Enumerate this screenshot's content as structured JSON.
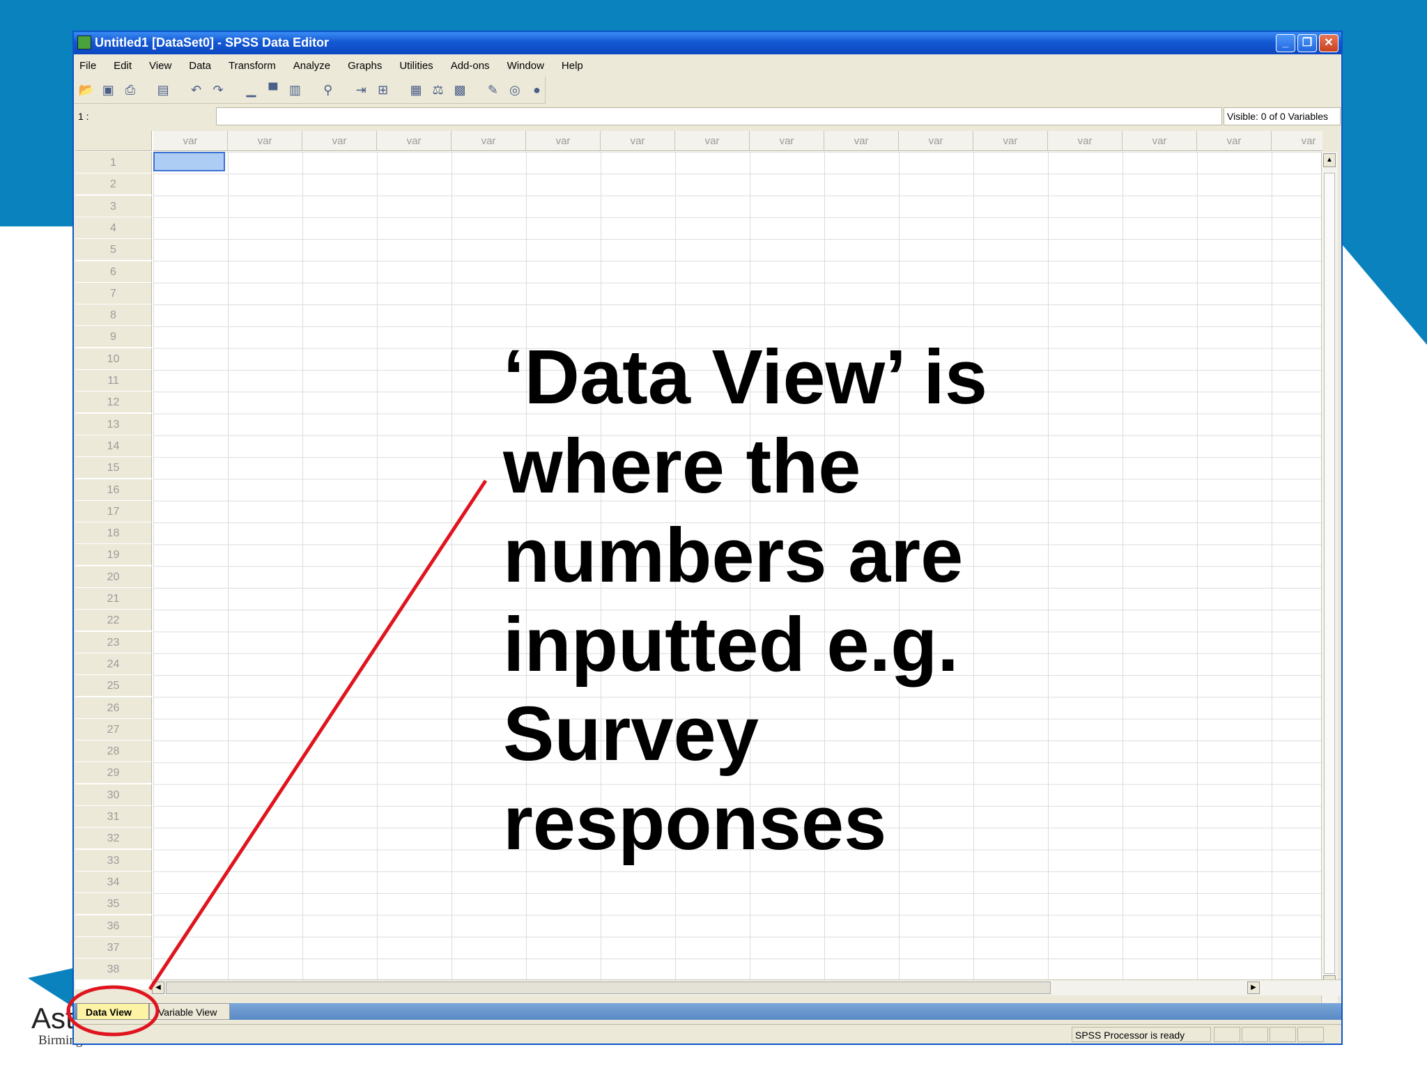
{
  "window": {
    "title": "Untitled1 [DataSet0] - SPSS Data Editor",
    "controls": [
      "_",
      "❐",
      "✕"
    ]
  },
  "menu": [
    "File",
    "Edit",
    "View",
    "Data",
    "Transform",
    "Analyze",
    "Graphs",
    "Utilities",
    "Add-ons",
    "Window",
    "Help"
  ],
  "toolbar_icons": [
    "open-file-icon",
    "save-icon",
    "print-icon",
    "dialog-recall-icon",
    "undo-icon",
    "redo-icon",
    "goto-case-icon",
    "goto-variable-icon",
    "variables-icon",
    "find-icon",
    "insert-cases-icon",
    "insert-variable-icon",
    "split-file-icon",
    "weight-cases-icon",
    "select-cases-icon",
    "value-labels-icon",
    "use-sets-icon",
    "show-all-variables-icon"
  ],
  "cell_ref": "1 :",
  "visible_info": "Visible: 0 of 0 Variables",
  "column_header": "var",
  "row_count": 38,
  "tabs": {
    "data_view": "Data View",
    "variable_view": "Variable View"
  },
  "status": "SPSS  Processor is ready",
  "annotation": [
    "‘Data View’ is",
    "where the",
    "numbers are",
    "inputted e.g.",
    "Survey",
    "responses"
  ],
  "logo": {
    "text": "Ast",
    "sub": "Birming"
  },
  "colors": {
    "slide_blue": "#0a82be",
    "titlebar": "#0c47c1",
    "annotation_red": "#e0141e",
    "active_tab": "#fdf3a4"
  }
}
